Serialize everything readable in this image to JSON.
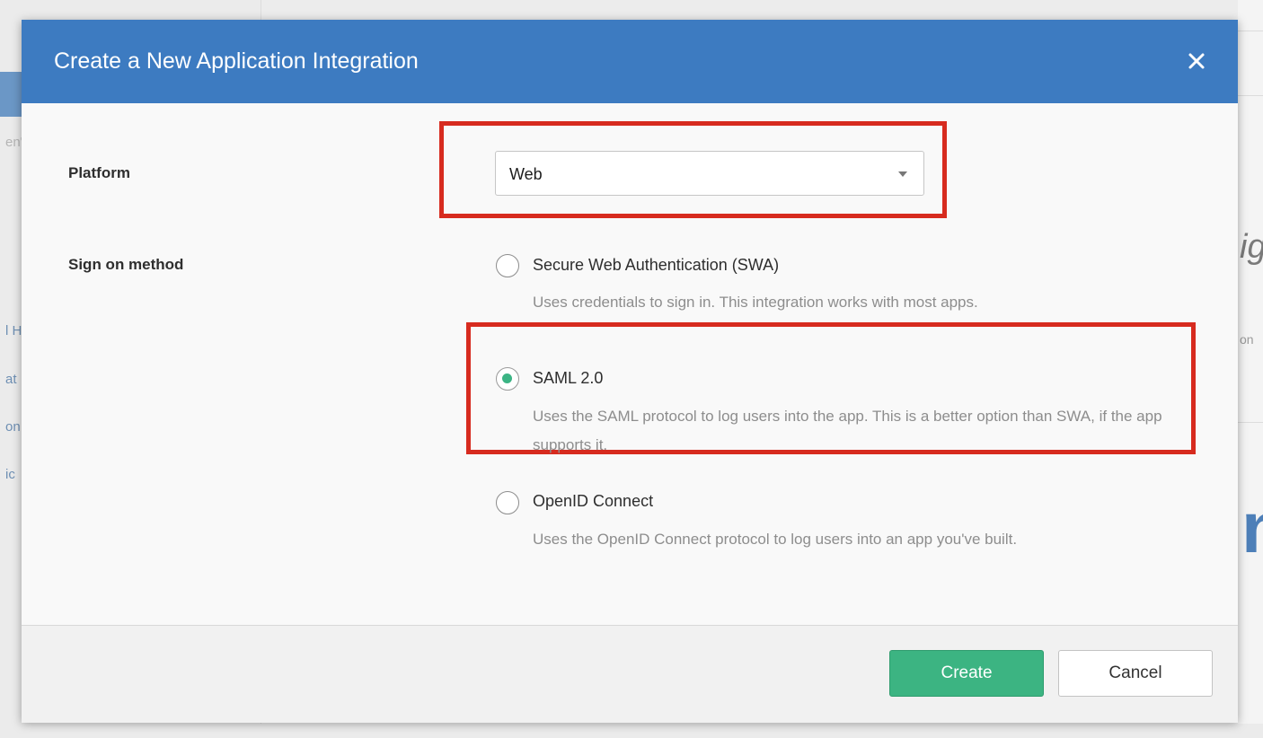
{
  "modal": {
    "title": "Create a New Application Integration",
    "close_icon": "close-icon"
  },
  "platform": {
    "label": "Platform",
    "selected": "Web"
  },
  "sign_on": {
    "label": "Sign on method",
    "options": [
      {
        "label": "Secure Web Authentication (SWA)",
        "description": "Uses credentials to sign in. This integration works with most apps.",
        "checked": false
      },
      {
        "label": "SAML 2.0",
        "description": "Uses the SAML protocol to log users into the app. This is a better option than SWA, if the app supports it.",
        "checked": true
      },
      {
        "label": "OpenID Connect",
        "description": "Uses the OpenID Connect protocol to log users into an app you've built.",
        "checked": false
      }
    ]
  },
  "buttons": {
    "create": "Create",
    "cancel": "Cancel"
  },
  "colors": {
    "header": "#3d7bc1",
    "primary_button": "#3cb482",
    "highlight": "#d72b1f",
    "radio_selected": "#3bb484"
  },
  "background": {
    "left_fragments": [
      "en'",
      "l H",
      "at",
      "on",
      "ic"
    ],
    "right_fragments": [
      "ig",
      "on",
      "n"
    ]
  }
}
